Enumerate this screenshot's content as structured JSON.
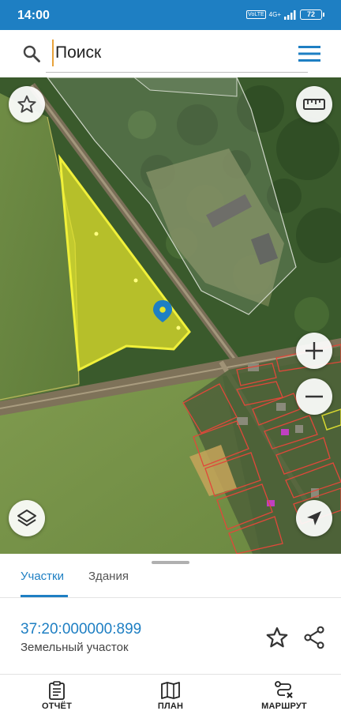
{
  "status_bar": {
    "time": "14:00",
    "volte_badge": "VoLTE",
    "network": "4G+",
    "battery": "72"
  },
  "search": {
    "placeholder": "Поиск"
  },
  "map": {
    "selected_parcel_color": "#e6e62a",
    "parcel_border_color": "#e0483a",
    "marker_color": "#1e7fc3"
  },
  "panel": {
    "tabs": [
      {
        "label": "Участки",
        "active": true
      },
      {
        "label": "Здания",
        "active": false
      }
    ],
    "parcel": {
      "number": "37:20:000000:899",
      "type": "Земельный участок"
    }
  },
  "bottom_nav": {
    "items": [
      {
        "label": "ОТЧЁТ",
        "icon": "report-icon"
      },
      {
        "label": "ПЛАН",
        "icon": "map-plan-icon"
      },
      {
        "label": "МАРШРУТ",
        "icon": "route-icon"
      }
    ]
  },
  "colors": {
    "primary": "#1e7fc3"
  }
}
